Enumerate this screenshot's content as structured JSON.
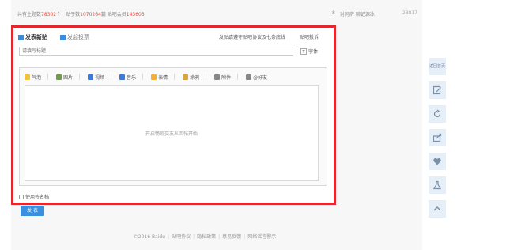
{
  "stats": {
    "prefix": "共有主题数",
    "topics": "78302",
    "mid1": "个，贴子数",
    "posts": "1070264",
    "mid2": "篇 贴吧会员",
    "members": "143603"
  },
  "side_thread": {
    "rank": "8",
    "title": "对阿萨 聊记源冰",
    "count": "28817"
  },
  "editor": {
    "tabs": [
      {
        "label": "发表新贴",
        "icon": "post-icon"
      },
      {
        "label": "发起投票",
        "icon": "vote-icon"
      }
    ],
    "rules_link": "发贴请遵守贴吧协议及七条底线",
    "help_link": "贴吧投诉",
    "title_placeholder": "请填写标题",
    "font_label": "字体",
    "font_icon": "font-icon",
    "toolbar": [
      {
        "label": "气泡",
        "icon": "emoji-icon"
      },
      {
        "label": "图片",
        "icon": "image-icon"
      },
      {
        "label": "视频",
        "icon": "video-icon"
      },
      {
        "label": "音乐",
        "icon": "music-icon"
      },
      {
        "label": "表情",
        "icon": "face-icon"
      },
      {
        "label": "涂鸦",
        "icon": "scribble-icon"
      },
      {
        "label": "附件",
        "icon": "attach-icon"
      },
      {
        "label": "@好友",
        "icon": "at-icon"
      }
    ],
    "body_placeholder": "开启畅聊交友从回帖开始",
    "terms_label": "使用签名档"
  },
  "submit_label": "发 表",
  "footer": {
    "copyright": "©2016 Baidu",
    "links": [
      "贴吧协议",
      "隐私政策",
      "意见反馈",
      "网络谣言警示"
    ]
  },
  "side_tools": [
    {
      "label": "返回首页",
      "icon": "home-text"
    },
    {
      "label": "",
      "icon": "edit-icon"
    },
    {
      "label": "",
      "icon": "refresh-icon"
    },
    {
      "label": "",
      "icon": "share-icon"
    },
    {
      "label": "",
      "icon": "heart-icon"
    },
    {
      "label": "",
      "icon": "flask-icon"
    },
    {
      "label": "",
      "icon": "arrow-up-icon"
    }
  ],
  "colors": {
    "accent": "#3a8fdf",
    "highlight_border": "#e0282e",
    "stat_number": "#e14b39",
    "side_button_bg": "#e6eef7"
  }
}
